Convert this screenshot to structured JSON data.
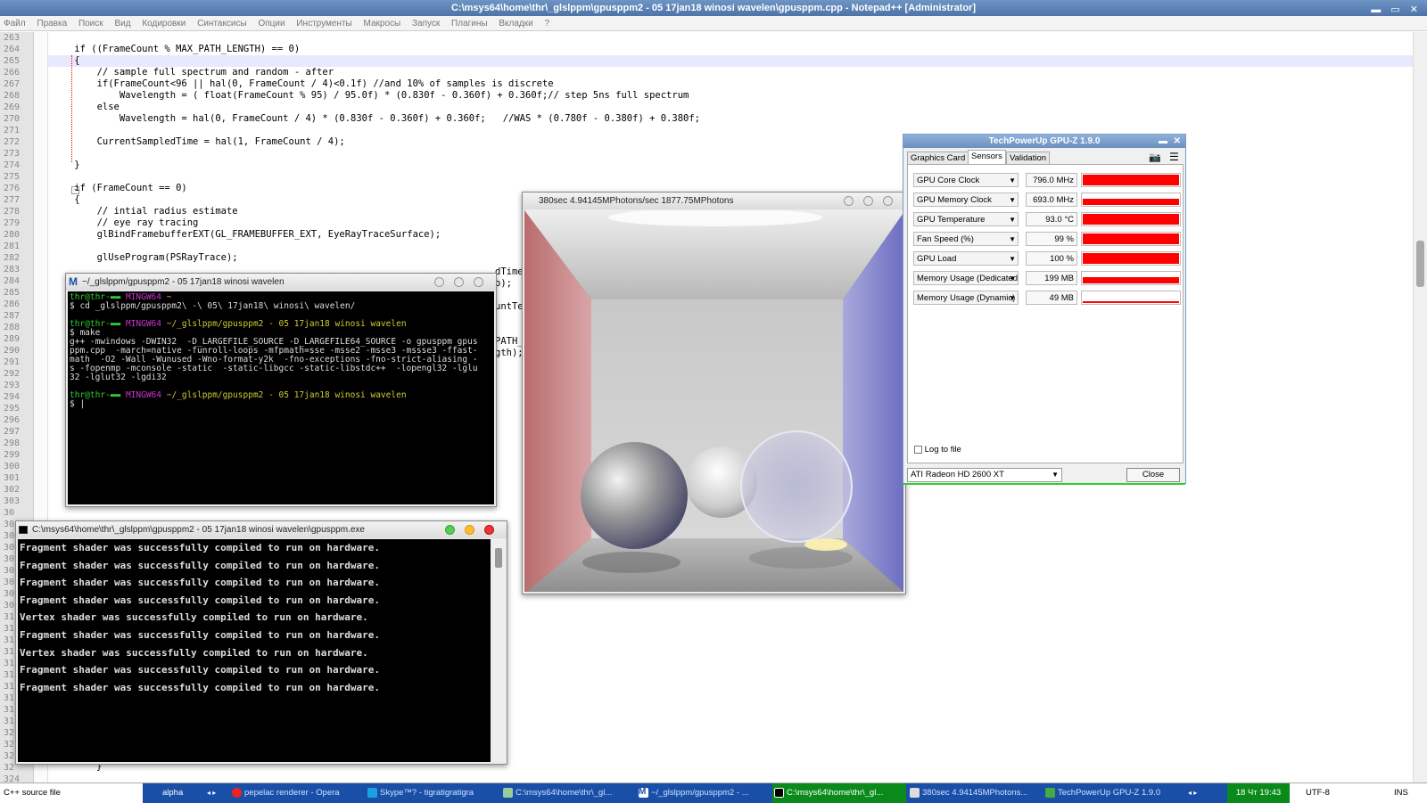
{
  "notepad": {
    "title": "C:\\msys64\\home\\thr\\_glslppm\\gpusppm2 - 05 17jan18 winosi wavelen\\gpusppm.cpp - Notepad++ [Administrator]",
    "window_controls": "▬ ▭ ✕",
    "menu": [
      "Файл",
      "Правка",
      "Поиск",
      "Вид",
      "Кодировки",
      "Синтаксисы",
      "Опции",
      "Инструменты",
      "Макросы",
      "Запуск",
      "Плагины",
      "Вкладки",
      "?"
    ],
    "line_numbers": [
      "263",
      "264",
      "265",
      "266",
      "267",
      "268",
      "269",
      "270",
      "271",
      "272",
      "273",
      "274",
      "275",
      "276",
      "277",
      "278",
      "279",
      "280",
      "281",
      "282",
      "283",
      "284",
      "285",
      "286",
      "287",
      "288",
      "289",
      "290",
      "291",
      "292",
      "293",
      "294",
      "295",
      "296",
      "297",
      "298",
      "299",
      "300",
      "301",
      "302",
      "303",
      "30",
      "30",
      "30",
      "30",
      "30",
      "30",
      "30",
      "30",
      "30",
      "31",
      "31",
      "31",
      "31",
      "31",
      "31",
      "31",
      "31",
      "31",
      "31",
      "32",
      "32",
      "32",
      "32",
      "324",
      "325"
    ],
    "code_lines": [
      {
        "text": "    if ((FrameCount % MAX_PATH_LENGTH) == 0)"
      },
      {
        "text": "    {"
      },
      {
        "text": "        // sample full spectrum and random - after"
      },
      {
        "text": "        if(FrameCount<96 || hal(0, FrameCount / 4)<0.1f) //and 10% of samples is discrete"
      },
      {
        "text": "            Wavelength = ( float(FrameCount % 95) / 95.0f) * (0.830f - 0.360f) + 0.360f;// step 5ns full spectrum"
      },
      {
        "text": "        else"
      },
      {
        "text": "            Wavelength = hal(0, FrameCount / 4) * (0.830f - 0.360f) + 0.360f;   //WAS * (0.780f - 0.380f) + 0.380f;"
      },
      {
        "text": ""
      },
      {
        "text": "        CurrentSampledTime = hal(1, FrameCount / 4);"
      },
      {
        "text": ""
      },
      {
        "text": "    }"
      },
      {
        "text": ""
      },
      {
        "text": "    if (FrameCount == 0)"
      },
      {
        "text": "    {"
      },
      {
        "text": "        // intial radius estimate"
      },
      {
        "text": "        // eye ray tracing"
      },
      {
        "text": "        glBindFramebufferEXT(GL_FRAMEBUFFER_EXT, EyeRayTraceSurface);"
      },
      {
        "text": ""
      },
      {
        "text": "        glUseProgram(PSRayTrace);"
      }
    ],
    "peek_fragments": [
      "dTime",
      "o);",
      "untTe",
      "PATH_",
      "gth);"
    ],
    "bottom_fragment": "}"
  },
  "terminal": {
    "title": "~/_glslppm/gpusppm2 - 05 17jan18 winosi wavelen",
    "prompt_user": "thr@thr-",
    "prompt_sys": "MINGW64",
    "lines": {
      "p1_path": "~",
      "cmd1": "$ cd _glslppm/gpusppm2\\ -\\ 05\\ 17jan18\\ winosi\\ wavelen/",
      "p2_path": "~/_glslppm/gpusppm2 - 05 17jan18 winosi wavelen",
      "cmd2": "$ make",
      "out1": "g++ -mwindows -DWIN32  -D_LARGEFILE_SOURCE -D_LARGEFILE64_SOURCE -o gpusppm gpus",
      "out2": "ppm.cpp  -march=native -funroll-loops -mfpmath=sse -msse2 -msse3 -mssse3 -ffast-",
      "out3": "math  -O2 -Wall -Wunused -Wno-format-y2k  -fno-exceptions -fno-strict-aliasing -",
      "out4": "s -fopenmp -mconsole -static  -static-libgcc -static-libstdc++  -lopengl32 -lglu",
      "out5": "32 -lglut32 -lgdi32",
      "p3_path": "~/_glslppm/gpusppm2 - 05 17jan18 winosi wavelen",
      "cmd3": "$ |"
    }
  },
  "console": {
    "title": "C:\\msys64\\home\\thr\\_glslppm\\gpusppm2 - 05 17jan18 winosi wavelen\\gpusppm.exe",
    "lines": [
      "Fragment shader was successfully compiled to run on hardware.",
      "Fragment shader was successfully compiled to run on hardware.",
      "Fragment shader was successfully compiled to run on hardware.",
      "Fragment shader was successfully compiled to run on hardware.",
      "Vertex shader was successfully compiled to run on hardware.",
      "Fragment shader was successfully compiled to run on hardware.",
      "Vertex shader was successfully compiled to run on hardware.",
      "Fragment shader was successfully compiled to run on hardware.",
      "Fragment shader was successfully compiled to run on hardware."
    ]
  },
  "render": {
    "title": "380sec 4.94145MPhotons/sec 1877.75MPhotons"
  },
  "gpuz": {
    "title": "TechPowerUp GPU-Z 1.9.0",
    "tabs": [
      "Graphics Card",
      "Sensors",
      "Validation"
    ],
    "sensors": [
      {
        "name": "GPU Core Clock",
        "value": "796.0 MHz",
        "fill": 1.0
      },
      {
        "name": "GPU Memory Clock",
        "value": "693.0 MHz",
        "fill": 0.55
      },
      {
        "name": "GPU Temperature",
        "value": "93.0 °C",
        "fill": 1.0
      },
      {
        "name": "Fan Speed (%)",
        "value": "99 %",
        "fill": 1.0
      },
      {
        "name": "GPU Load",
        "value": "100 %",
        "fill": 1.0
      },
      {
        "name": "Memory Usage (Dedicated)",
        "value": "199 MB",
        "fill": 0.6
      },
      {
        "name": "Memory Usage (Dynamic)",
        "value": "49 MB",
        "fill": 0.12
      }
    ],
    "log_to_file": "Log to file",
    "gpu_select": "ATI Radeon HD 2600 XT",
    "close": "Close",
    "colors": {
      "bar": "#ff0000"
    }
  },
  "taskbar": {
    "left_label": "C++ source file",
    "desktop": "alpha",
    "items": [
      "pepelac renderer - Opera",
      "Skype™? - tigratigratigra",
      "C:\\msys64\\home\\thr\\_gl...",
      "~/_glslppm/gpusppm2 - ...",
      "C:\\msys64\\home\\thr\\_gl...",
      "380sec 4.94145MPhotons...",
      "TechPowerUp GPU-Z 1.9.0"
    ],
    "clock": "18 Чт 19:43",
    "encoding": "UTF-8",
    "mode": "INS"
  }
}
